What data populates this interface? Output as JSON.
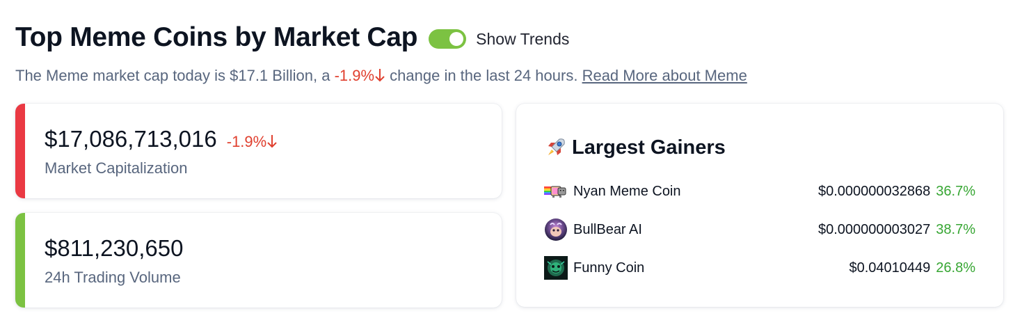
{
  "header": {
    "title": "Top Meme Coins by Market Cap",
    "toggle_label": "Show Trends",
    "toggle_on": true,
    "toggle_color": "#7cc242"
  },
  "subtitle": {
    "prefix": "The Meme market cap today is $17.1 Billion, a ",
    "change": "-1.9%",
    "suffix": " change in the last 24 hours. ",
    "link": "Read More about Meme"
  },
  "stats": {
    "market_cap": {
      "value": "$17,086,713,016",
      "change": "-1.9%",
      "label": "Market Capitalization",
      "accent": "#ea3943"
    },
    "volume": {
      "value": "$811,230,650",
      "label": "24h Trading Volume",
      "accent": "#7cc242"
    }
  },
  "gainers": {
    "title": "Largest Gainers",
    "icon": "rocket-icon",
    "items": [
      {
        "name": "Nyan Meme Coin",
        "price": "$0.000000032868",
        "change": "36.7%",
        "icon": "nyan-cat-icon"
      },
      {
        "name": "BullBear AI",
        "price": "$0.000000003027",
        "change": "38.7%",
        "icon": "bullbear-icon"
      },
      {
        "name": "Funny Coin",
        "price": "$0.04010449",
        "change": "26.8%",
        "icon": "funny-coin-icon"
      }
    ]
  },
  "colors": {
    "negative": "#e0402f",
    "positive": "#37a633"
  }
}
